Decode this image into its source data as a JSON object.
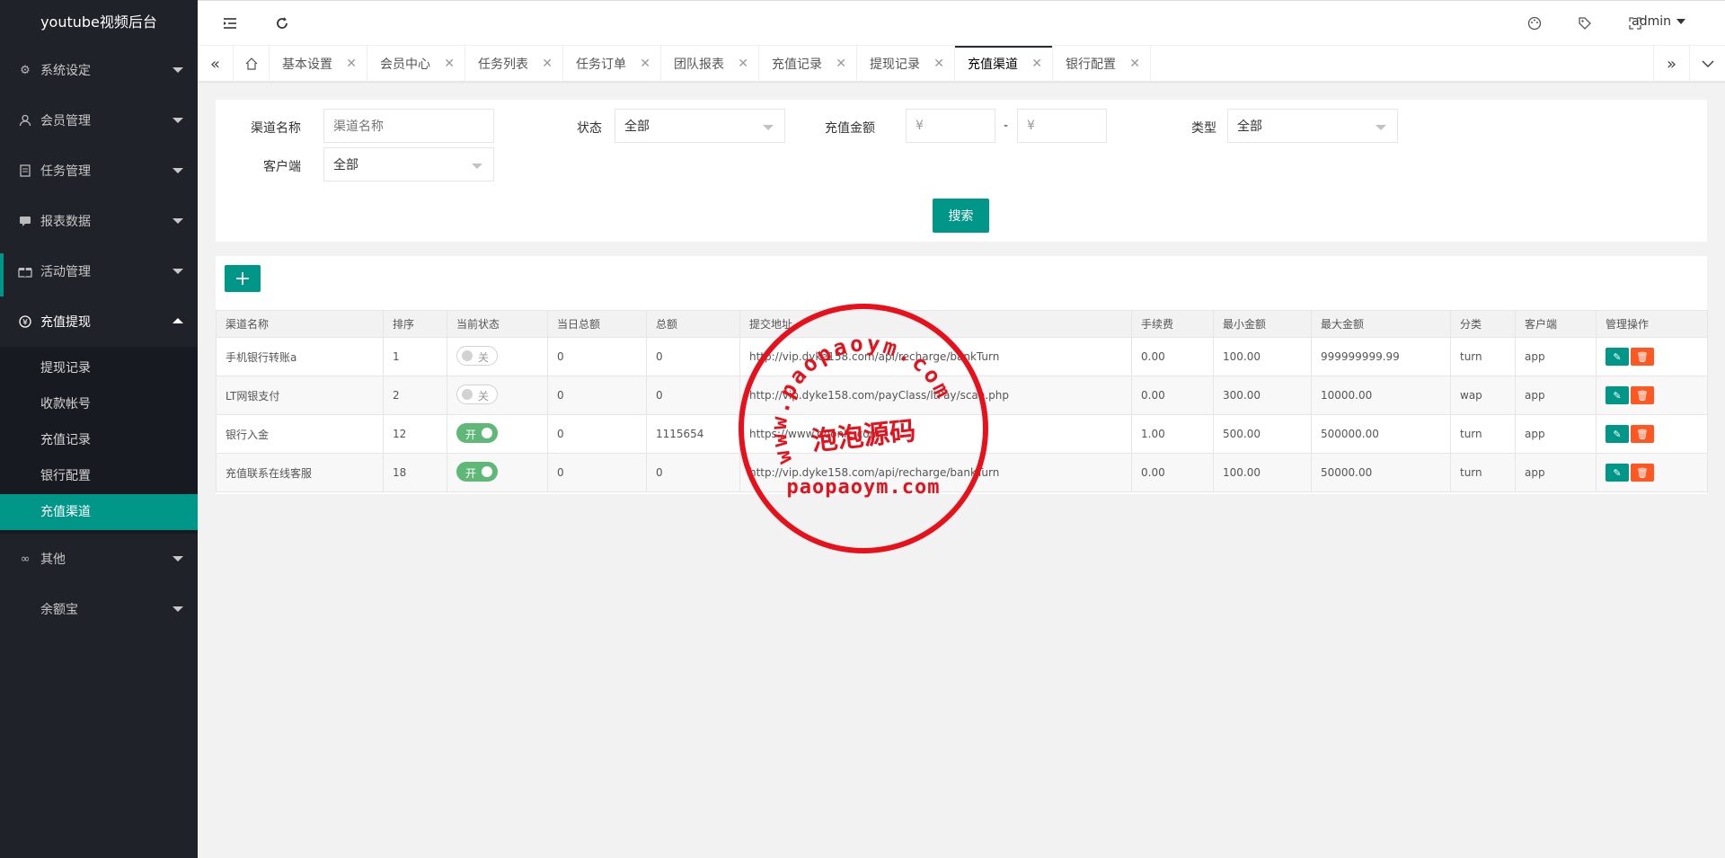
{
  "app": {
    "title": "youtube视频后台",
    "user": "admin"
  },
  "sidebar": {
    "items": [
      {
        "label": "系统设定",
        "icon": "gear-icon"
      },
      {
        "label": "会员管理",
        "icon": "user-icon"
      },
      {
        "label": "任务管理",
        "icon": "document-icon"
      },
      {
        "label": "报表数据",
        "icon": "chat-icon"
      },
      {
        "label": "活动管理",
        "icon": "gift-icon"
      },
      {
        "label": "充值提现",
        "icon": "yen-icon"
      },
      {
        "label": "其他",
        "icon": "infinity-icon"
      },
      {
        "label": "余额宝",
        "icon": ""
      }
    ],
    "sub": [
      {
        "label": "提现记录"
      },
      {
        "label": "收款帐号"
      },
      {
        "label": "充值记录"
      },
      {
        "label": "银行配置"
      },
      {
        "label": "充值渠道"
      }
    ]
  },
  "tabs": [
    {
      "label": "基本设置"
    },
    {
      "label": "会员中心"
    },
    {
      "label": "任务列表"
    },
    {
      "label": "任务订单"
    },
    {
      "label": "团队报表"
    },
    {
      "label": "充值记录"
    },
    {
      "label": "提现记录"
    },
    {
      "label": "充值渠道"
    },
    {
      "label": "银行配置"
    }
  ],
  "filter": {
    "name_label": "渠道名称",
    "name_placeholder": "渠道名称",
    "status_label": "状态",
    "status_value": "全部",
    "amount_label": "充值金额",
    "amount_min_placeholder": "¥",
    "amount_max_placeholder": "¥",
    "dash": "-",
    "type_label": "类型",
    "type_value": "全部",
    "client_label": "客户端",
    "client_value": "全部",
    "search_button": "搜索"
  },
  "table": {
    "add_button": "+",
    "headers": [
      "渠道名称",
      "排序",
      "当前状态",
      "当日总额",
      "总额",
      "提交地址",
      "手续费",
      "最小金额",
      "最大金额",
      "分类",
      "客户端",
      "管理操作"
    ],
    "rows": [
      {
        "name": "手机银行转账a",
        "sort": "1",
        "status": "关",
        "status_on": false,
        "today": "0",
        "total": "0",
        "url": "http://vip.dyke158.com/api/recharge/bankTurn",
        "fee": "0.00",
        "min": "100.00",
        "max": "999999999.99",
        "cat": "turn",
        "client": "app"
      },
      {
        "name": "LT网银支付",
        "sort": "2",
        "status": "关",
        "status_on": false,
        "today": "0",
        "total": "0",
        "url": "http://vip.dyke158.com/payClass/ltPay/scan.php",
        "fee": "0.00",
        "min": "300.00",
        "max": "10000.00",
        "cat": "wap",
        "client": "app"
      },
      {
        "name": "银行入金",
        "sort": "12",
        "status": "开",
        "status_on": true,
        "today": "0",
        "total": "1115654",
        "url": "https://www.doonle.com",
        "fee": "1.00",
        "min": "500.00",
        "max": "500000.00",
        "cat": "turn",
        "client": "app"
      },
      {
        "name": "充值联系在线客服",
        "sort": "18",
        "status": "开",
        "status_on": true,
        "today": "0",
        "total": "0",
        "url": "http://vip.dyke158.com/api/recharge/bankTurn",
        "fee": "0.00",
        "min": "100.00",
        "max": "50000.00",
        "cat": "turn",
        "client": "app"
      }
    ]
  },
  "watermark": {
    "arc_text": "www.paopaoym.com",
    "cn_text": "泡泡源码",
    "en_text": "paopaoym.com"
  },
  "colors": {
    "accent": "#009688",
    "sidebar": "#20222a",
    "danger": "#ff5722",
    "switch_on": "#5fb878",
    "stamp": "#e8101a"
  }
}
